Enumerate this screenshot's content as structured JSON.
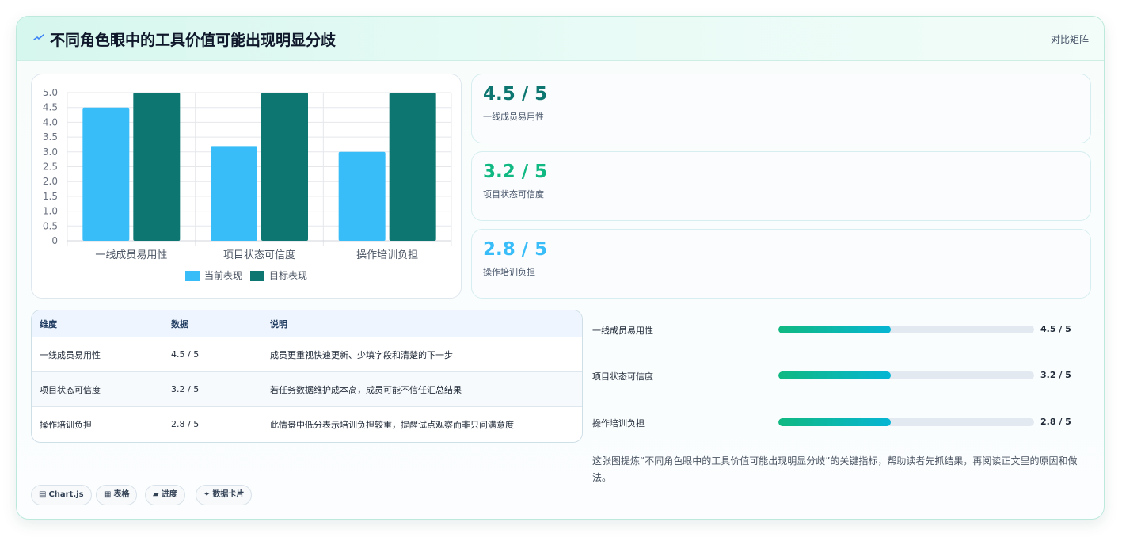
{
  "header": {
    "title": "不同角色眼中的工具价值可能出现明显分歧",
    "title_icon": "lightning-icon",
    "right_label": "对比矩阵"
  },
  "colors": {
    "current": "#38bdf8",
    "target": "#0d7670",
    "stat_primary": "#0d7670",
    "stat_secondary": "#10b981",
    "stat_tertiary": "#38bdf8"
  },
  "chart_data": {
    "type": "bar",
    "categories": [
      "一线成员易用性",
      "项目状态可信度",
      "操作培训负担"
    ],
    "series": [
      {
        "name": "当前表现",
        "values": [
          4.5,
          3.2,
          3.0
        ]
      },
      {
        "name": "目标表现",
        "values": [
          5,
          5,
          5
        ]
      }
    ],
    "ylim": [
      0,
      5
    ],
    "yticks": [
      "0",
      "0.5",
      "1.0",
      "1.5",
      "2.0",
      "2.5",
      "3.0",
      "3.5",
      "4.0",
      "4.5",
      "5.0"
    ],
    "grid": true,
    "legend": "bottom"
  },
  "stats": [
    {
      "value": "4.5 / 5",
      "label": "一线成员易用性"
    },
    {
      "value": "3.2 / 5",
      "label": "项目状态可信度"
    },
    {
      "value": "2.8 / 5",
      "label": "操作培训负担"
    }
  ],
  "table": {
    "headers": [
      "维度",
      "数据",
      "说明"
    ],
    "rows": [
      [
        "一线成员易用性",
        "4.5 / 5",
        "成员更重视快速更新、少填字段和清楚的下一步"
      ],
      [
        "项目状态可信度",
        "3.2 / 5",
        "若任务数据维护成本高，成员可能不信任汇总结果"
      ],
      [
        "操作培训负担",
        "2.8 / 5",
        "此情景中低分表示培训负担较重，提醒试点观察而非只问满意度"
      ]
    ]
  },
  "progress": [
    {
      "label": "一线成员易用性",
      "value": "4.5 / 5",
      "fill": 0.44
    },
    {
      "label": "项目状态可信度",
      "value": "3.2 / 5",
      "fill": 0.44
    },
    {
      "label": "操作培训负担",
      "value": "2.8 / 5",
      "fill": 0.44
    }
  ],
  "note": "这张图提炼“不同角色眼中的工具价值可能出现明显分歧”的关键指标，帮助读者先抓结果，再阅读正文里的原因和做法。",
  "tags": [
    {
      "icon": "▤",
      "icon_name": "chart-icon",
      "label": "Chart.js"
    },
    {
      "icon": "▦",
      "icon_name": "table-icon",
      "label": "表格"
    },
    {
      "icon": "▰",
      "icon_name": "progress-icon",
      "label": "进度"
    },
    {
      "icon": "✦",
      "icon_name": "sparkle-icon",
      "label": "数据卡片"
    }
  ]
}
